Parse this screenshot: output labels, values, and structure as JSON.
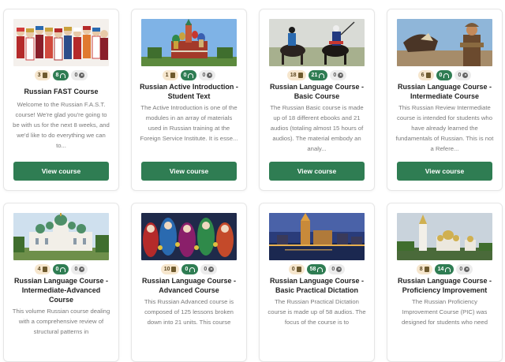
{
  "colors": {
    "accent": "#2f7d53",
    "book_badge": "#f6e6cd",
    "video_badge": "#ececec"
  },
  "cards": [
    {
      "title": "Russian FAST Course",
      "books": "3",
      "audios": "8",
      "videos": "0",
      "description": "Welcome to the Russian F.A.S.T. course! We're glad you're going to be with us for the next 8 weeks, and we'd like to do everything we can to...",
      "button": "View course"
    },
    {
      "title": "Russian Active Introduction - Student Text",
      "books": "1",
      "audios": "0",
      "videos": "0",
      "description": "The Active Introduction is one of the modules in an array of materials used in Russian training at the Foreign Service Institute. It is esse...",
      "button": "View course"
    },
    {
      "title": "Russian Language Course - Basic Course",
      "books": "18",
      "audios": "21",
      "videos": "0",
      "description": "The Russian Basic course is made up of 18 different ebooks and 21 audios (totaling almost 15 hours of audios). The material embody an analy...",
      "button": "View course"
    },
    {
      "title": "Russian Language Course - Intermediate Course",
      "books": "6",
      "audios": "0",
      "videos": "0",
      "description": "This Russian Review Intermediate course is intended for students who have already learned the fundamentals of Russian. This is not a Refere...",
      "button": "View course"
    },
    {
      "title": "Russian Language Course - Intermediate-Advanced Course",
      "books": "4",
      "audios": "0",
      "videos": "0",
      "description": "This volume Russian course dealing with a comprehensive review of structural patterns in",
      "button": ""
    },
    {
      "title": "Russian Language Course - Advanced Course",
      "books": "10",
      "audios": "0",
      "videos": "0",
      "description": "This Russian Advanced course is composed of 125 lessons broken down into 21 units. This course",
      "button": ""
    },
    {
      "title": "Russian Language Course - Basic Practical Dictation",
      "books": "0",
      "audios": "58",
      "videos": "0",
      "description": "The Russian Practical Dictation course is made up of 58 audios. The focus of the course is to",
      "button": ""
    },
    {
      "title": "Russian Language Course - Proficiency Improvement",
      "books": "8",
      "audios": "14",
      "videos": "0",
      "description": "The Russian Proficiency Improvement Course (PIC) was designed for students who need",
      "button": ""
    }
  ]
}
